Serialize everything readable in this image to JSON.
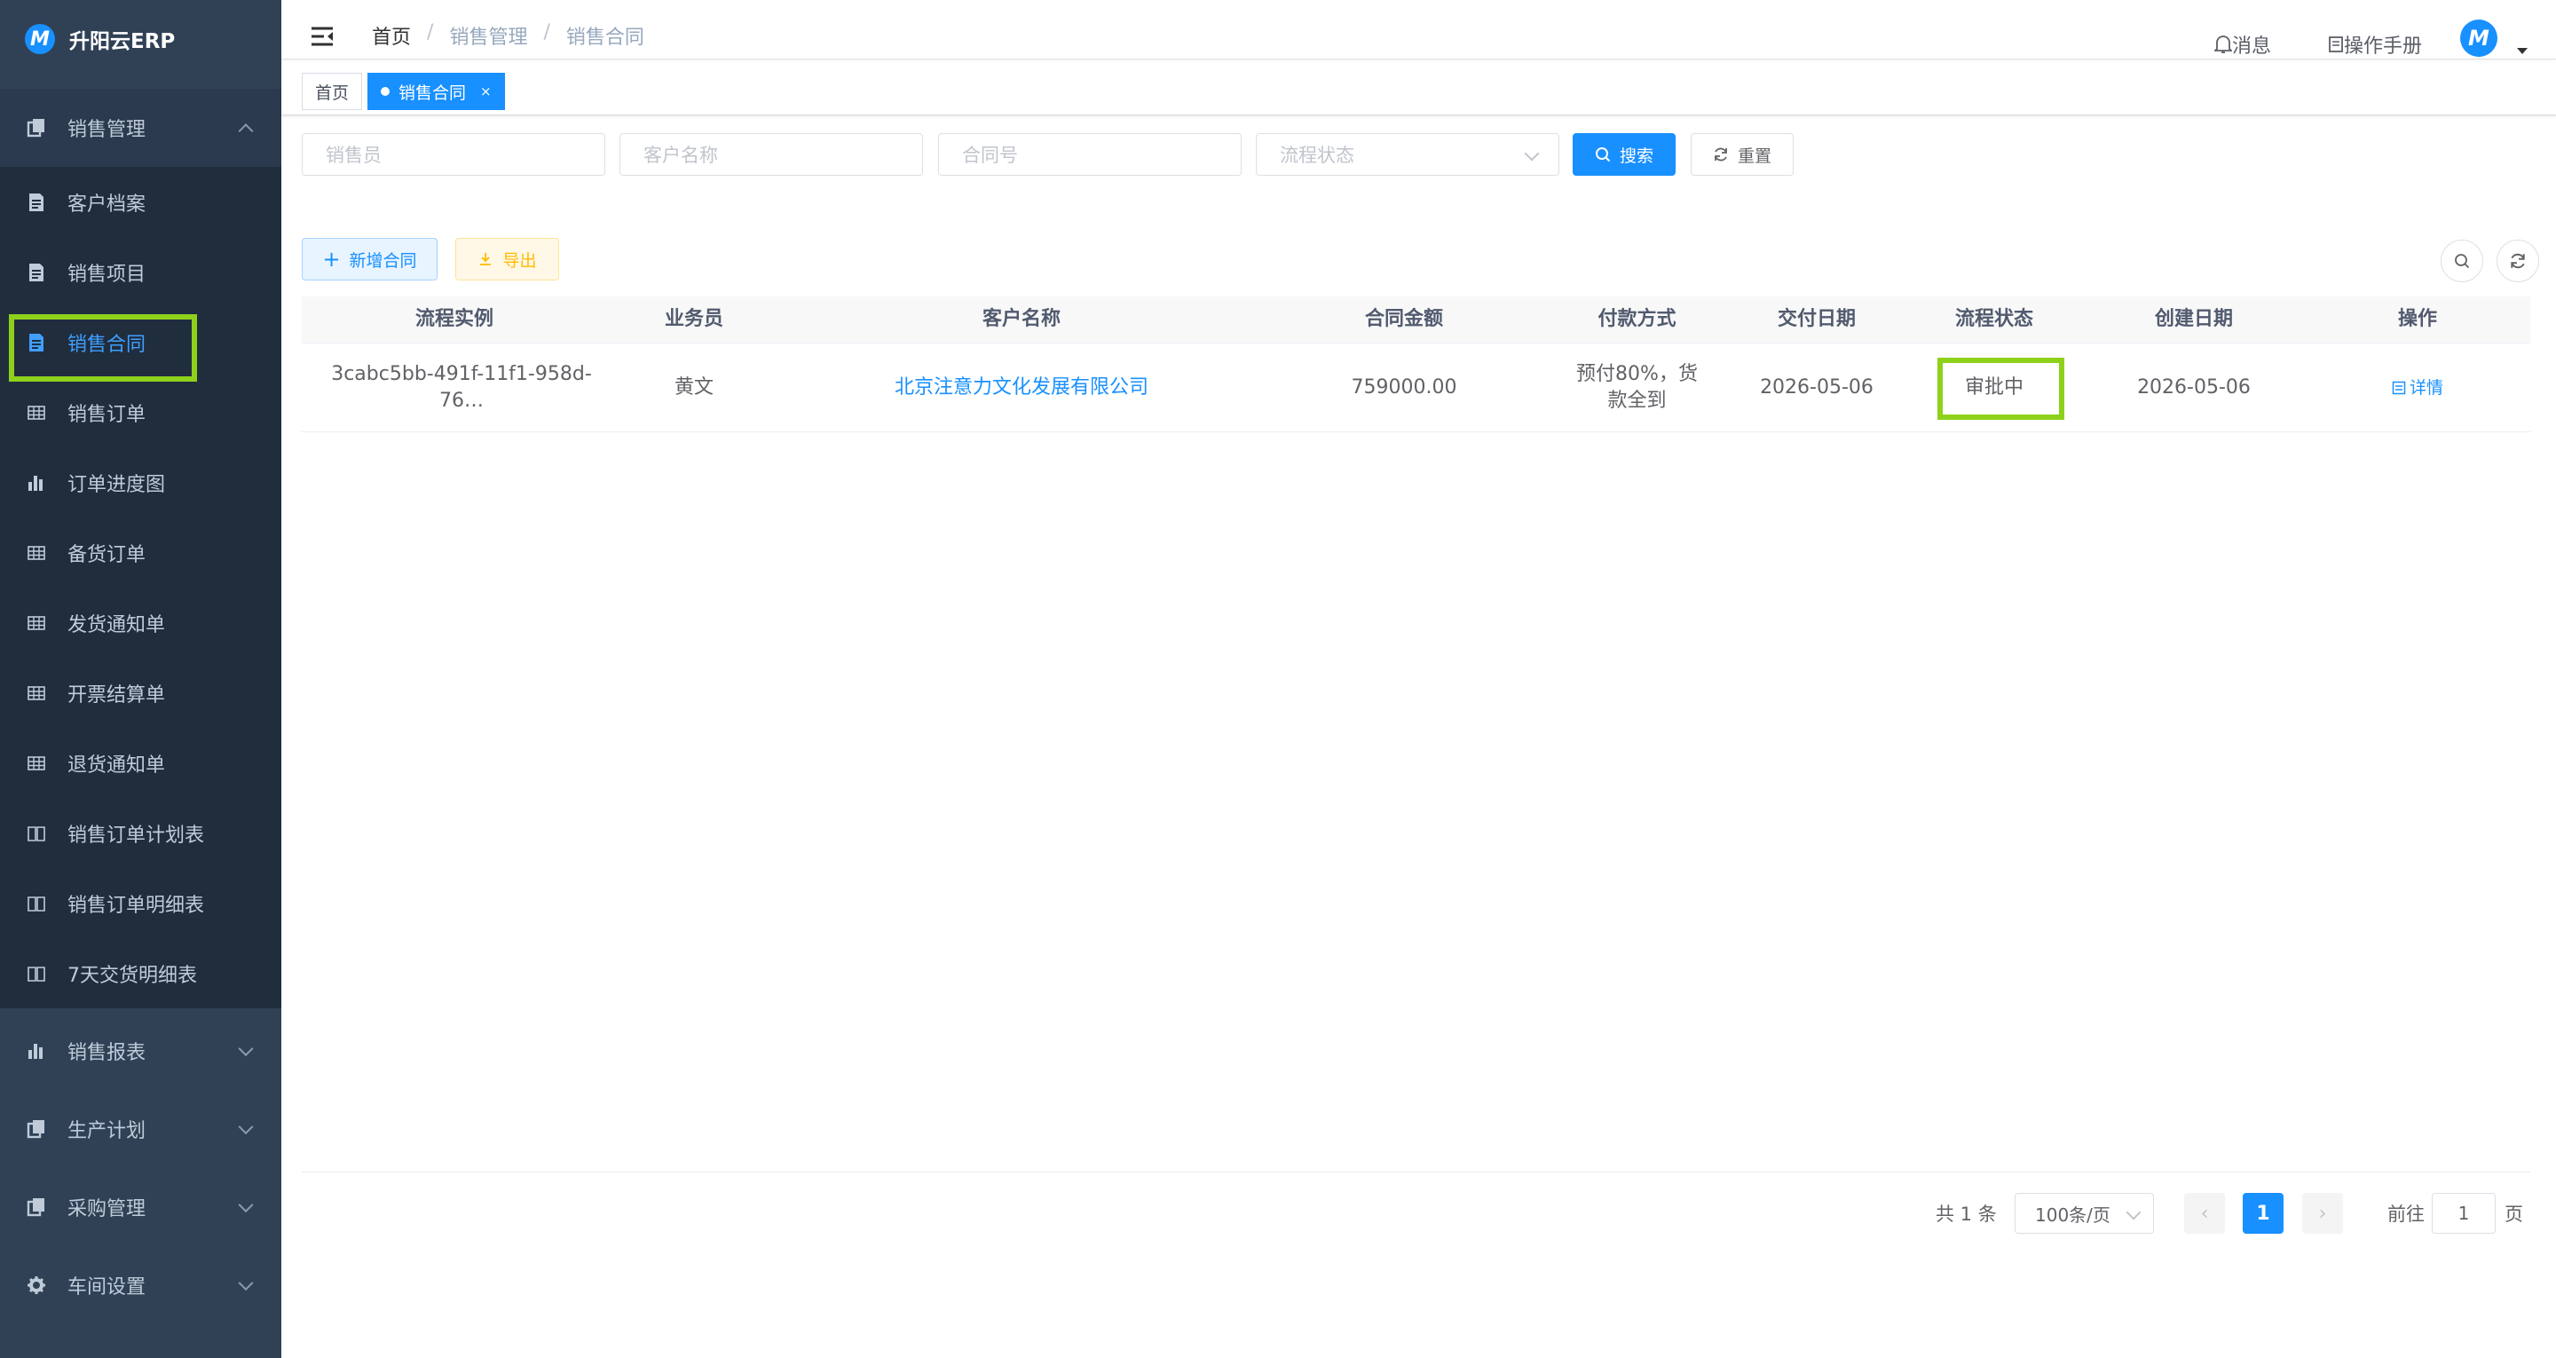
{
  "app": {
    "title": "升阳云ERP",
    "logo_letter": "M"
  },
  "sidebar": {
    "groups": [
      {
        "label": "销售管理",
        "icon": "document-stack-icon",
        "expanded": true
      },
      {
        "label": "销售报表",
        "icon": "bar-chart-icon",
        "expanded": false
      },
      {
        "label": "生产计划",
        "icon": "document-stack-icon",
        "expanded": false
      },
      {
        "label": "采购管理",
        "icon": "document-stack-icon",
        "expanded": false
      },
      {
        "label": "车间设置",
        "icon": "gear-icon",
        "expanded": false
      }
    ],
    "items": [
      {
        "label": "客户档案",
        "icon": "document-icon"
      },
      {
        "label": "销售项目",
        "icon": "document-icon"
      },
      {
        "label": "销售合同",
        "icon": "document-icon",
        "active": true
      },
      {
        "label": "销售订单",
        "icon": "table-icon"
      },
      {
        "label": "订单进度图",
        "icon": "bar-chart-icon"
      },
      {
        "label": "备货订单",
        "icon": "table-icon"
      },
      {
        "label": "发货通知单",
        "icon": "table-icon"
      },
      {
        "label": "开票结算单",
        "icon": "table-icon"
      },
      {
        "label": "退货通知单",
        "icon": "table-icon"
      },
      {
        "label": "销售订单计划表",
        "icon": "book-icon"
      },
      {
        "label": "销售订单明细表",
        "icon": "book-icon"
      },
      {
        "label": "7天交货明细表",
        "icon": "book-icon"
      }
    ]
  },
  "header": {
    "breadcrumb": [
      "首页",
      "销售管理",
      "销售合同"
    ],
    "messages_label": "消息",
    "manual_label": "操作手册"
  },
  "tags": [
    {
      "label": "首页",
      "active": false
    },
    {
      "label": "销售合同",
      "active": true,
      "close": "×"
    }
  ],
  "search": {
    "salesperson_placeholder": "销售员",
    "customer_placeholder": "客户名称",
    "contract_no_placeholder": "合同号",
    "status_placeholder": "流程状态",
    "search_label": "搜索",
    "reset_label": "重置"
  },
  "toolbar": {
    "add_label": "新增合同",
    "export_label": "导出"
  },
  "table": {
    "columns": [
      "流程实例",
      "业务员",
      "客户名称",
      "合同金额",
      "付款方式",
      "交付日期",
      "流程状态",
      "创建日期",
      "操作"
    ],
    "rows": [
      {
        "instance": "3cabc5bb-491f-11f1-958d-76…",
        "salesperson": "黄文",
        "customer": "北京注意力文化发展有限公司",
        "amount": "759000.00",
        "payment": "预付80%，货款全到",
        "delivery_date": "2026-05-06",
        "status": "审批中",
        "created_date": "2026-05-06",
        "action": "详情"
      }
    ]
  },
  "pagination": {
    "total_label": "共 1 条",
    "page_size": "100条/页",
    "current_page": "1",
    "goto_label": "前往",
    "goto_value": "1",
    "page_suffix": "页"
  },
  "colors": {
    "sidebar_bg": "#304156",
    "submenu_bg": "#1f2d3d",
    "primary": "#1890ff",
    "highlight": "#8ed11b",
    "warning": "#ffba00"
  }
}
